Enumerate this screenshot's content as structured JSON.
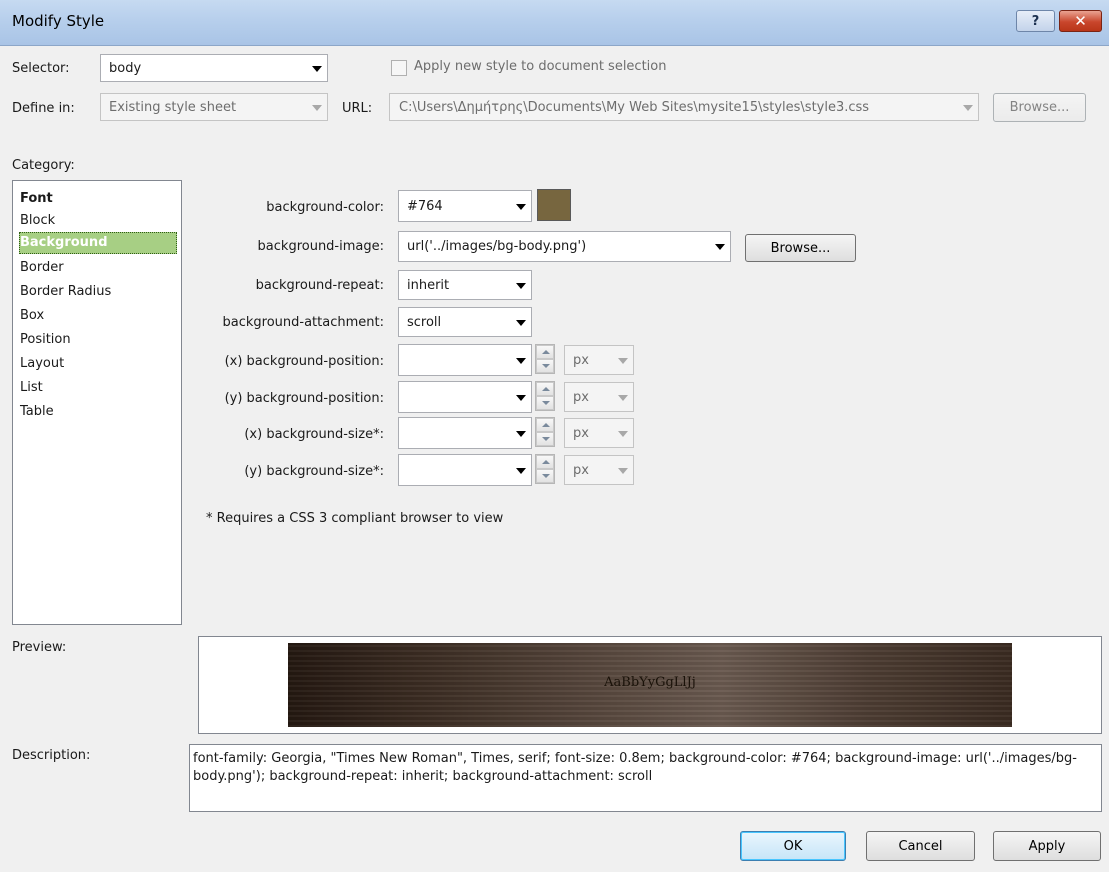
{
  "window": {
    "title": "Modify Style",
    "help_glyph": "?",
    "close_glyph": "✕"
  },
  "top": {
    "selector_label": "Selector:",
    "selector_value": "body",
    "apply_checkbox_label": "Apply new style to document selection",
    "define_in_label": "Define in:",
    "define_in_value": "Existing style sheet",
    "url_label": "URL:",
    "url_value": "C:\\Users\\Δημήτρης\\Documents\\My Web Sites\\mysite15\\styles\\style3.css",
    "browse_label": "Browse..."
  },
  "category": {
    "label": "Category:",
    "items": [
      "Font",
      "Block",
      "Background",
      "Border",
      "Border Radius",
      "Box",
      "Position",
      "Layout",
      "List",
      "Table"
    ],
    "selected": "Background"
  },
  "form": {
    "bg_color_label": "background-color:",
    "bg_color_value": "#764",
    "bg_color_swatch": "#77663f",
    "bg_image_label": "background-image:",
    "bg_image_value": "url('../images/bg-body.png')",
    "bg_image_browse": "Browse...",
    "bg_repeat_label": "background-repeat:",
    "bg_repeat_value": "inherit",
    "bg_attach_label": "background-attachment:",
    "bg_attach_value": "scroll",
    "pos_x_label": "(x) background-position:",
    "pos_y_label": "(y) background-position:",
    "size_x_label": "(x) background-size*:",
    "size_y_label": "(y) background-size*:",
    "unit": "px",
    "note": "* Requires a CSS 3 compliant browser to view"
  },
  "preview": {
    "label": "Preview:",
    "sample_text": "AaBbYyGgLlJj"
  },
  "description": {
    "label": "Description:",
    "text": "font-family: Georgia, \"Times New Roman\", Times, serif; font-size: 0.8em; background-color: #764; background-image: url('../images/bg-body.png'); background-repeat: inherit; background-attachment: scroll"
  },
  "buttons": {
    "ok": "OK",
    "cancel": "Cancel",
    "apply": "Apply"
  }
}
